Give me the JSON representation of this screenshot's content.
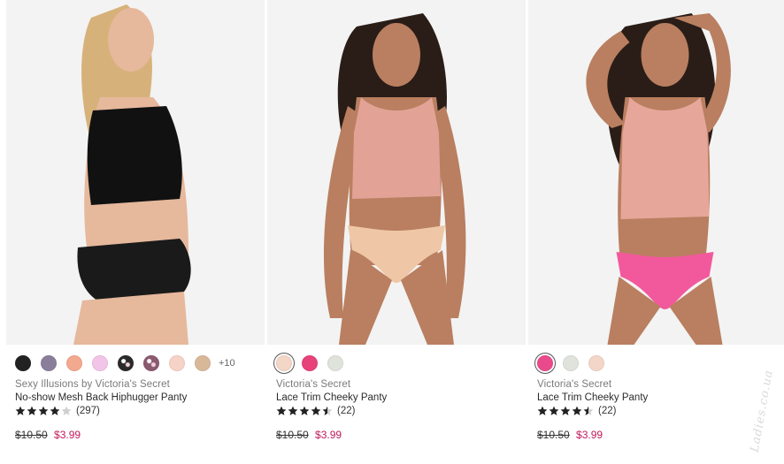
{
  "products": [
    {
      "swatches": [
        "#222222",
        "#8a7f9a",
        "#f3a98f",
        "#f2c4e8",
        "#2a2a2a",
        "#8b5a6e",
        "#f7d2c7",
        "#d9b89a"
      ],
      "swatch_pattern": [
        false,
        false,
        false,
        false,
        true,
        true,
        false,
        false
      ],
      "more_colors": "+10",
      "brand": "Sexy Illusions by Victoria's Secret",
      "name": "No-show Mesh Back Hiphugger Panty",
      "rating": 4,
      "reviews": "(297)",
      "old_price": "$10.50",
      "sale_price": "$3.99",
      "photo": {
        "top_color": "#111111",
        "bottom_color": "#1a1a1a",
        "skin": "#e6b89c",
        "hair": "#d6b27a",
        "pose": "back"
      }
    },
    {
      "swatches": [
        "#f3d6c6",
        "#e8427a",
        "#dfe3dc"
      ],
      "swatch_pattern": [
        false,
        false,
        false
      ],
      "selected_swatch": 0,
      "more_colors": "",
      "brand": "Victoria's Secret",
      "name": "Lace Trim Cheeky Panty",
      "rating": 4.5,
      "reviews": "(22)",
      "old_price": "$10.50",
      "sale_price": "$3.99",
      "photo": {
        "top_color": "#e2a396",
        "bottom_color": "#efc7a6",
        "skin": "#b97f60",
        "hair": "#2a1d17",
        "pose": "front"
      }
    },
    {
      "swatches": [
        "#ea4a8c",
        "#dfe3dc",
        "#f4d6c8"
      ],
      "swatch_pattern": [
        false,
        false,
        false
      ],
      "selected_swatch": 0,
      "more_colors": "",
      "brand": "Victoria's Secret",
      "name": "Lace Trim Cheeky Panty",
      "rating": 4.5,
      "reviews": "(22)",
      "old_price": "$10.50",
      "sale_price": "$3.99",
      "photo": {
        "top_color": "#e7a69a",
        "bottom_color": "#f2599c",
        "skin": "#b97f60",
        "hair": "#2a1d17",
        "pose": "arms-up"
      }
    }
  ],
  "watermark": "Ladies.co.ua",
  "colors": {
    "sale": "#c2185b",
    "star": "#222222",
    "star_empty": "#cfcfcf"
  }
}
